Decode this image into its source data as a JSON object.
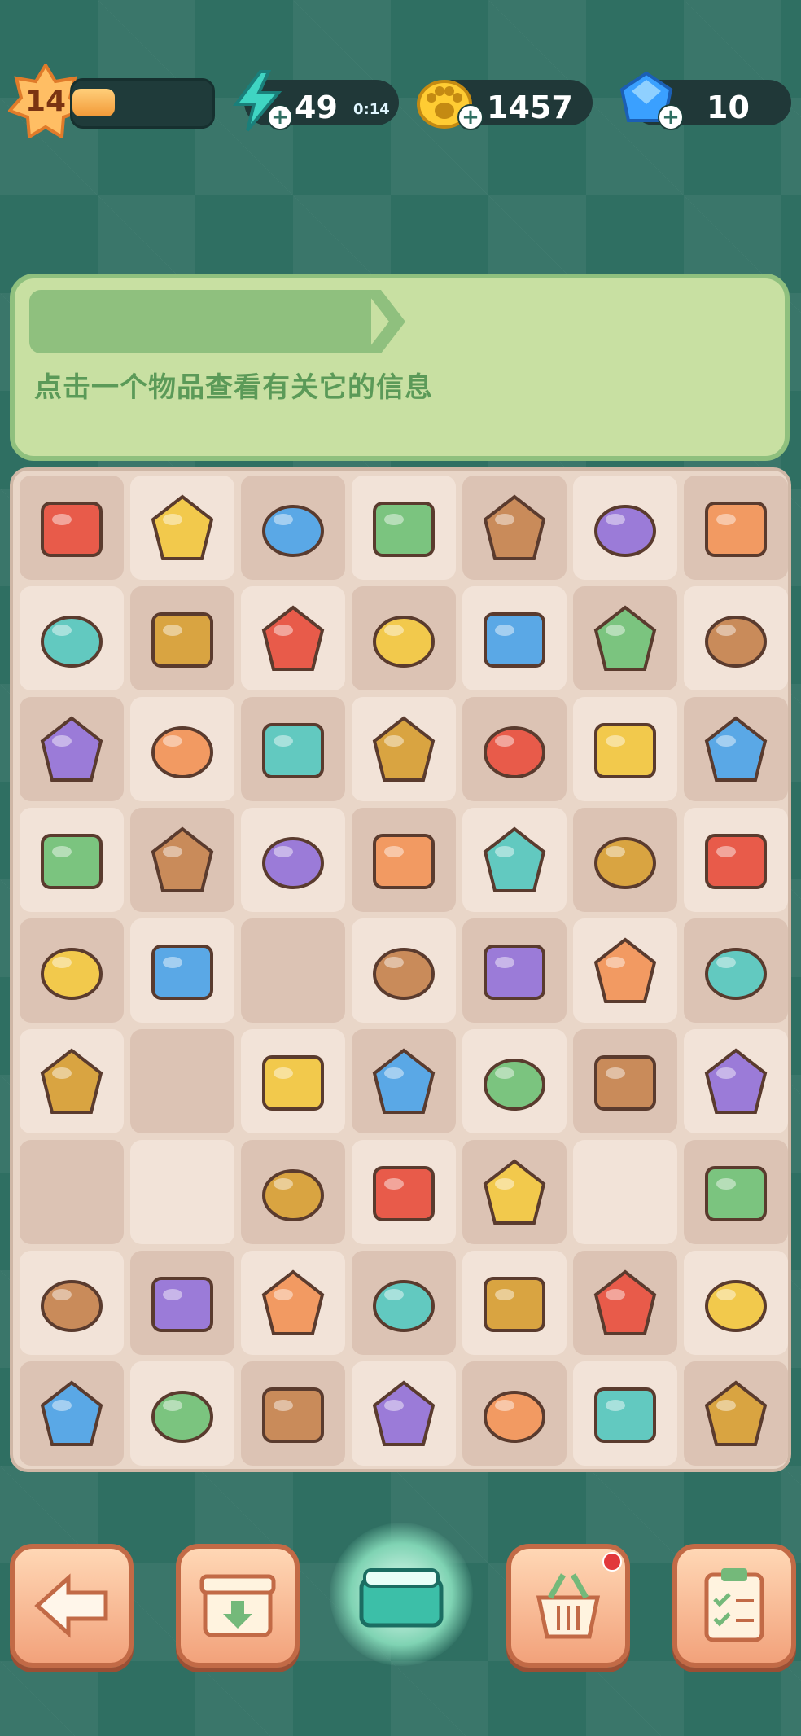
{
  "hud": {
    "level": "14",
    "xp_fraction": 0.3,
    "energy": "49",
    "energy_timer": "0:14",
    "paws": "1457",
    "gems": "10",
    "plus_label": "+"
  },
  "info_panel": {
    "text": "点击一个物品查看有关它的信息"
  },
  "colors": {
    "background": "#2f6f62",
    "panel": "#c8e0a2",
    "accent_text": "#5b9a58",
    "board": "#e9d6c8"
  },
  "board": {
    "cells": [
      [
        "gift-box-icon",
        "lightning-pitcher-icon",
        "cardboard-box-icon",
        "blue-fish-icon",
        "wrapped-gift-icon",
        "treasure-chest-icon",
        "metal-pipe-icon"
      ],
      [
        "yellow-cloth-icon",
        "battery-icon",
        "shopping-bag-icon",
        "trash-can-icon",
        "fridge-drawer-icon",
        "trash-can-icon",
        "rope-icon"
      ],
      [
        "drawer-icon",
        "scarf-icon",
        "small-fish-icon",
        "pipe-icon",
        "ice-cube-icon",
        "cola-drinks-icon",
        "vegetable-crate-icon"
      ],
      [
        "paw-coins-pile-icon",
        "paw-coins-icon",
        "gold-star-icon",
        "green-vase-icon",
        "mop-icon",
        "sewing-box-icon",
        "wooden-cabinet-icon"
      ],
      [
        "cotton-rack-icon",
        "red-button-icon",
        "",
        "tube-icon",
        "fish-jar-icon",
        "water-bottle-icon",
        "cheese-icon"
      ],
      [
        "coin-pouch-icon",
        "",
        "trowel-icon",
        "fish-cookie-icon",
        "sack-icon",
        "blue-fabric-icon",
        "blue-leaves-icon"
      ],
      [
        "",
        "",
        "steel-wool-icon",
        "flower-bud-icon",
        "beans-icon",
        "",
        "potted-plant-icon"
      ],
      [
        "eggs-icon",
        "gold-bars-icon",
        "short-pipe-icon",
        "scoop-icon",
        "rake-icon",
        "food-plate-icon",
        "blue-bird-icon"
      ],
      [
        "refrigerator-icon",
        "cracked-egg-icon",
        "yellow-basket-icon",
        "flower-vase-icon",
        "pink-loom-icon",
        "loom-icon",
        "flyer-box-icon"
      ]
    ]
  },
  "bottom_bar": {
    "back_icon": "back-arrow-icon",
    "storage_icon": "storage-box-icon",
    "center_icon": "toolbox-icon",
    "shop_icon": "basket-icon",
    "tasks_icon": "clipboard-icon"
  }
}
